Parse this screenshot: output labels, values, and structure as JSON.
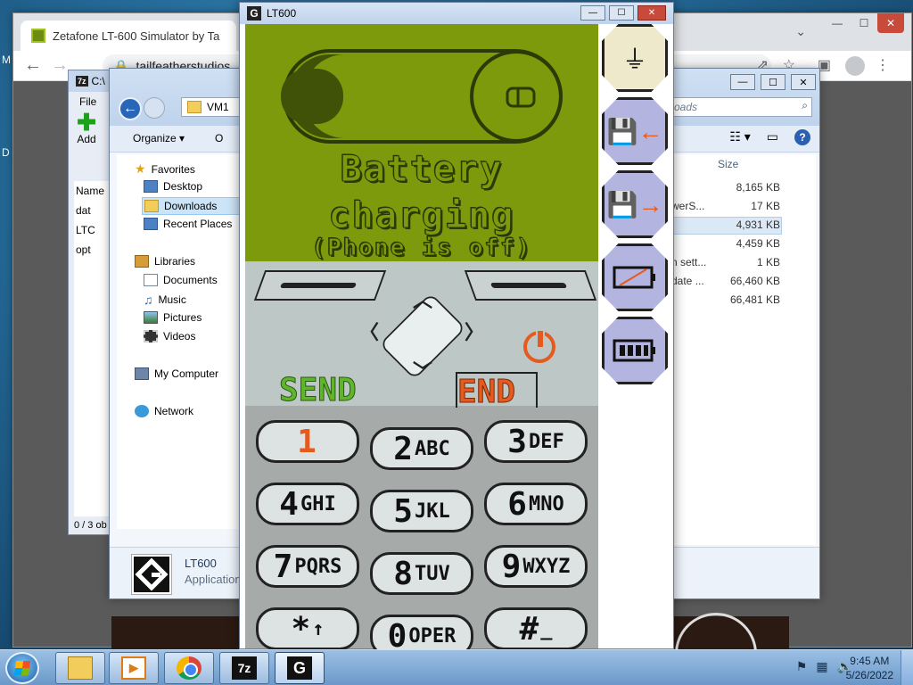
{
  "desktop": {
    "letters": [
      "M",
      "D"
    ]
  },
  "chrome": {
    "tab_title": "Zetafone LT-600 Simulator by Ta",
    "url": "tailfeatherstudios",
    "controls": {
      "minimize": "—",
      "maximize": "☐",
      "close": "✕"
    },
    "icons": {
      "back": "arrow-left-icon",
      "forward": "arrow-right-icon",
      "reload": "reload-icon"
    }
  },
  "zip": {
    "title": "C:\\",
    "logo": "7z",
    "menu": "File",
    "add_label": "Add",
    "column": "Name",
    "rows": [
      "dat",
      "LTC",
      "opt"
    ],
    "status": "0 / 3 ob"
  },
  "explorer": {
    "address": "VM1",
    "search_placeholder": "oads",
    "organize": "Organize",
    "organize2": "O",
    "nav": {
      "favorites": "Favorites",
      "desktop": "Desktop",
      "downloads": "Downloads",
      "recent": "Recent Places",
      "libraries": "Libraries",
      "documents": "Documents",
      "music": "Music",
      "pictures": "Pictures",
      "videos": "Videos",
      "computer": "My Computer",
      "network": "Network"
    },
    "size_header": "Size",
    "files": [
      {
        "name": "",
        "size": "8,165 KB"
      },
      {
        "name": "werS...",
        "size": "17 KB"
      },
      {
        "name": "",
        "size": "4,931 KB"
      },
      {
        "name": "",
        "size": "4,459 KB"
      },
      {
        "name": "n sett...",
        "size": "1 KB"
      },
      {
        "name": "date ...",
        "size": "66,460 KB"
      },
      {
        "name": "",
        "size": "66,481 KB"
      }
    ],
    "details": {
      "name": "LT600",
      "type": "Application"
    }
  },
  "sim": {
    "title": "LT600",
    "screen": {
      "line1": "Battery",
      "line2": "charging",
      "line3": "(Phone is off)"
    },
    "send_label": "SEND",
    "end_label": "END",
    "keys": [
      {
        "digit": "1",
        "letters": ""
      },
      {
        "digit": "2",
        "letters": "ABC"
      },
      {
        "digit": "3",
        "letters": "DEF"
      },
      {
        "digit": "4",
        "letters": "GHI"
      },
      {
        "digit": "5",
        "letters": "JKL"
      },
      {
        "digit": "6",
        "letters": "MNO"
      },
      {
        "digit": "7",
        "letters": "PQRS"
      },
      {
        "digit": "8",
        "letters": "TUV"
      },
      {
        "digit": "9",
        "letters": "WXYZ"
      },
      {
        "digit": "*",
        "letters": "↑"
      },
      {
        "digit": "0",
        "letters": "OPER"
      },
      {
        "digit": "#",
        "letters": "_"
      }
    ]
  },
  "taskbar": {
    "time": "9:45 AM",
    "date": "5/26/2022",
    "zip_label": "7z",
    "lt_label": "G"
  }
}
